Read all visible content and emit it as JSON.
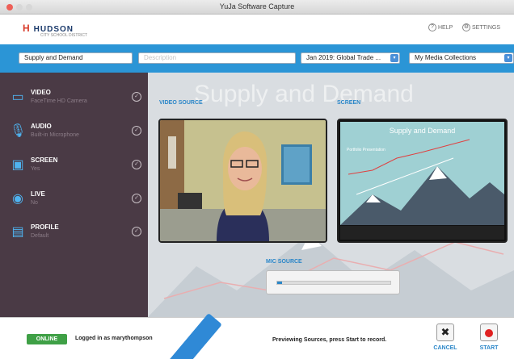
{
  "window": {
    "title": "YuJa Software Capture"
  },
  "brand": {
    "name": "HUDSON",
    "tagline": "CITY SCHOOL DISTRICT"
  },
  "toplinks": {
    "help": "HELP",
    "settings": "SETTINGS"
  },
  "fields": {
    "title_value": "Supply and Demand",
    "description_placeholder": "Description",
    "course_value": "Jan 2019: Global Trade ...",
    "collection_value": "My Media Collections"
  },
  "sidebar": {
    "items": [
      {
        "label": "VIDEO",
        "sub": "FaceTime HD Camera",
        "icon": "video-icon"
      },
      {
        "label": "AUDIO",
        "sub": "Built-in Microphone",
        "icon": "microphone-icon"
      },
      {
        "label": "SCREEN",
        "sub": "Yes",
        "icon": "screen-icon"
      },
      {
        "label": "LIVE",
        "sub": "No",
        "icon": "live-broadcast-icon"
      },
      {
        "label": "PROFILE",
        "sub": "Default",
        "icon": "profile-icon"
      }
    ]
  },
  "main": {
    "watermark": "Supply and Demand",
    "video_source_label": "VIDEO SOURCE",
    "screen_label": "SCREEN",
    "mic_source_label": "MIC SOURCE",
    "mic_level": 0.04,
    "slide": {
      "title": "Supply and Demand",
      "lines": [
        "Portfolio Presentation"
      ]
    }
  },
  "footer": {
    "status_badge": "ONLINE",
    "logged_in": "Logged in as marythompson",
    "preview_text": "Previewing Sources, press Start to record.",
    "cancel_label": "CANCEL",
    "start_label": "START"
  },
  "colors": {
    "accent_blue": "#2b95d6",
    "sidebar_bg": "#4a3a45",
    "online_green": "#3fa046",
    "record_red": "#e02020"
  }
}
